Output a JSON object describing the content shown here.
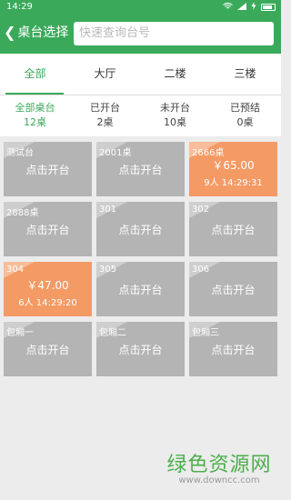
{
  "status_bar": {
    "time": "14:29"
  },
  "header": {
    "back_label": "桌台选择",
    "search_placeholder": "快速查询台号"
  },
  "tabs": [
    {
      "label": "全部",
      "active": true
    },
    {
      "label": "大厅",
      "active": false
    },
    {
      "label": "二楼",
      "active": false
    },
    {
      "label": "三楼",
      "active": false
    }
  ],
  "summary": [
    {
      "label": "全部桌台",
      "count": "12桌",
      "active": true
    },
    {
      "label": "已开台",
      "count": "2桌",
      "active": false
    },
    {
      "label": "未开台",
      "count": "10桌",
      "active": false
    },
    {
      "label": "已预结",
      "count": "0桌",
      "active": false
    }
  ],
  "tables": [
    {
      "name": "测试台",
      "text": "点击开台"
    },
    {
      "name": "2001桌",
      "text": "点击开台"
    },
    {
      "name": "2666桌",
      "amount": "￥65.00",
      "info": "9人 14:29:31"
    },
    {
      "name": "2888桌",
      "text": "点击开台"
    },
    {
      "name": "301",
      "text": "点击开台"
    },
    {
      "name": "302",
      "text": "点击开台"
    },
    {
      "name": "304",
      "amount": "￥47.00",
      "info": "6人 14:29:20"
    },
    {
      "name": "305",
      "text": "点击开台"
    },
    {
      "name": "306",
      "text": "点击开台"
    },
    {
      "name": "包厢一",
      "text": "点击开台"
    },
    {
      "name": "包厢二",
      "text": "点击开台"
    },
    {
      "name": "包厢三",
      "text": "点击开台"
    }
  ],
  "watermark": {
    "title": "绿色资源网",
    "url": "www.downcc.com"
  },
  "colors": {
    "primary": "#3aaa5a",
    "occupied": "#f49a65",
    "free": "#b4b4b4"
  }
}
